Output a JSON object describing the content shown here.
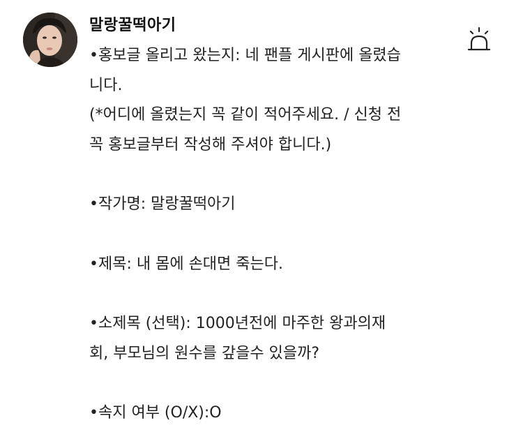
{
  "post": {
    "author": "말랑꿀떡아기",
    "report_icon": "siren-icon",
    "lines": [
      "•홍보글 올리고 왔는지: 네 팬플 게시판에 올렸습",
      "니다.",
      "(*어디에 올렸는지 꼭 같이 적어주세요. / 신청 전",
      "꼭 홍보글부터 작성해 주셔야 합니다.)",
      "",
      "•작가명: 말랑꿀떡아기",
      "",
      "•제목: 내 몸에 손대면 죽는다.",
      "",
      "•소제목 (선택):  1000년전에 마주한 왕과의재",
      "회, 부모님의 원수를 갚을수 있을까?",
      "",
      "•속지 여부 (O/X):O"
    ]
  }
}
